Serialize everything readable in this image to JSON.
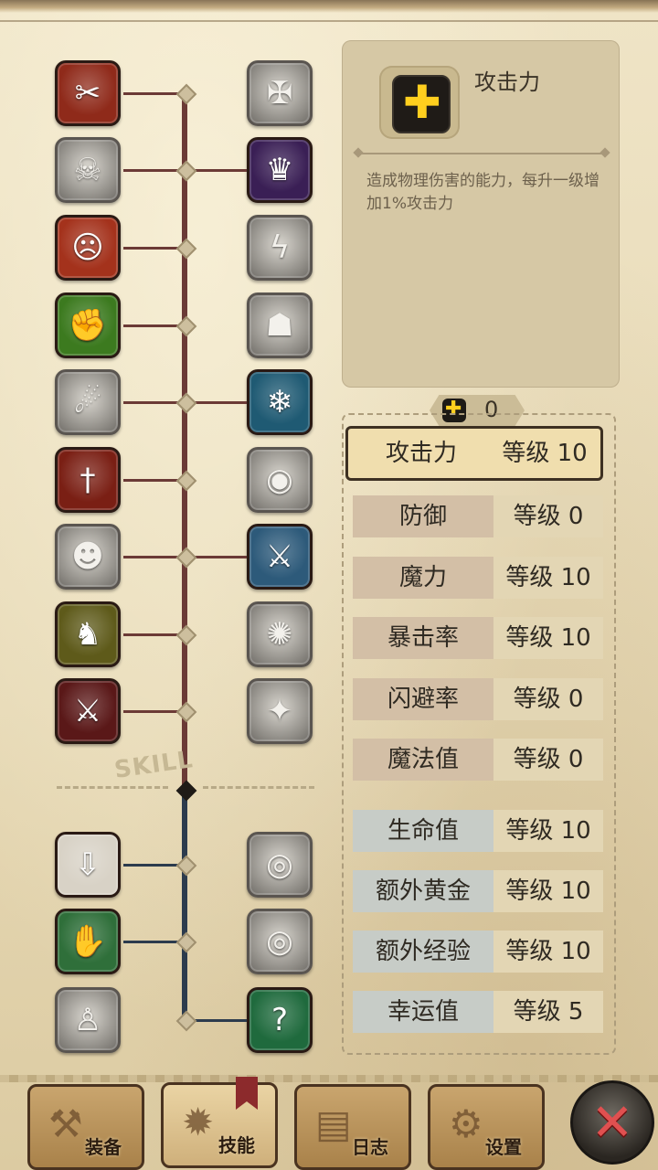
{
  "tree": {
    "section_label": "SKILL",
    "skills_left": [
      {
        "icon": "claw-slash-icon",
        "locked": false,
        "bg": "#8f2a1a",
        "glyph": "✂"
      },
      {
        "icon": "figure-fall-icon",
        "locked": true,
        "glyph": "☠"
      },
      {
        "icon": "rage-demon-icon",
        "locked": false,
        "bg": "#a4321c",
        "glyph": "☹"
      },
      {
        "icon": "muscle-arm-icon",
        "locked": false,
        "bg": "#3c7a1f",
        "glyph": "✊"
      },
      {
        "icon": "whirl-slash-icon",
        "locked": true,
        "glyph": "☄"
      },
      {
        "icon": "dagger-icon",
        "locked": false,
        "bg": "#7a1f14",
        "glyph": "†"
      },
      {
        "icon": "dash-figure-icon",
        "locked": true,
        "glyph": "☻"
      },
      {
        "icon": "golden-golem-icon",
        "locked": false,
        "bg": "#5e5a1a",
        "glyph": "♞"
      },
      {
        "icon": "cross-blade-icon",
        "locked": false,
        "bg": "#5a1818",
        "glyph": "⚔"
      },
      {
        "icon": "potion-chest-red-icon",
        "locked": false,
        "bg": "#d8d2c6",
        "glyph": "⇩"
      },
      {
        "icon": "potion-chest-green-icon",
        "locked": false,
        "bg": "#2f6f3a",
        "glyph": "✋"
      },
      {
        "icon": "soul-figure-icon",
        "locked": true,
        "glyph": "♙"
      }
    ],
    "skills_right": [
      {
        "icon": "shield-cross-icon",
        "locked": true,
        "glyph": "✠"
      },
      {
        "icon": "shadow-reaper-icon",
        "locked": false,
        "bg": "#3a1f55",
        "glyph": "♛"
      },
      {
        "icon": "lightning-icon",
        "locked": true,
        "glyph": "ϟ"
      },
      {
        "icon": "charge-figure-icon",
        "locked": true,
        "glyph": "☗"
      },
      {
        "icon": "ice-spirit-icon",
        "locked": false,
        "bg": "#1f5a73",
        "glyph": "❄"
      },
      {
        "icon": "eye-burst-icon",
        "locked": true,
        "glyph": "◉"
      },
      {
        "icon": "sword-whirl-icon",
        "locked": false,
        "bg": "#2d5a7a",
        "glyph": "⚔"
      },
      {
        "icon": "dust-cloud-icon",
        "locked": true,
        "glyph": "✺"
      },
      {
        "icon": "sparkle-figure-icon",
        "locked": true,
        "glyph": "✦"
      },
      {
        "icon": "eye-chest-icon",
        "locked": true,
        "glyph": "◎"
      },
      {
        "icon": "eye-chest-2-icon",
        "locked": true,
        "glyph": "◎"
      },
      {
        "icon": "mystery-figure-icon",
        "locked": false,
        "bg": "#1f6a3d",
        "glyph": "?"
      }
    ]
  },
  "info": {
    "icon": "plus-icon",
    "title": "攻击力",
    "description": "造成物理伤害的能力，每升一级增加1%攻击力"
  },
  "points": {
    "icon": "plus-icon",
    "value": "0"
  },
  "stats": [
    {
      "name": "攻击力",
      "level": "等级 10",
      "selected": true,
      "group": "tan"
    },
    {
      "name": "防御",
      "level": "等级 0",
      "selected": false,
      "group": "tan"
    },
    {
      "name": "魔力",
      "level": "等级 10",
      "selected": false,
      "group": "tan"
    },
    {
      "name": "暴击率",
      "level": "等级 10",
      "selected": false,
      "group": "tan"
    },
    {
      "name": "闪避率",
      "level": "等级 0",
      "selected": false,
      "group": "tan"
    },
    {
      "name": "魔法值",
      "level": "等级 0",
      "selected": false,
      "group": "tan"
    },
    {
      "name": "生命值",
      "level": "等级 10",
      "selected": false,
      "group": "blue"
    },
    {
      "name": "额外黄金",
      "level": "等级 10",
      "selected": false,
      "group": "blue"
    },
    {
      "name": "额外经验",
      "level": "等级 10",
      "selected": false,
      "group": "blue"
    },
    {
      "name": "幸运值",
      "level": "等级 5",
      "selected": false,
      "group": "blue"
    }
  ],
  "tabs": [
    {
      "label": "装备",
      "icon": "axe-icon",
      "active": false
    },
    {
      "label": "技能",
      "icon": "skill-emblem-icon",
      "active": true
    },
    {
      "label": "日志",
      "icon": "scroll-icon",
      "active": false
    },
    {
      "label": "设置",
      "icon": "gear-icon",
      "active": false
    }
  ],
  "close": {
    "icon": "close-icon",
    "glyph": "✕"
  },
  "colors": {
    "accent_yellow": "#ffcf1e",
    "tree_red": "#6b3a36",
    "tree_blue": "#2c3b4d"
  }
}
